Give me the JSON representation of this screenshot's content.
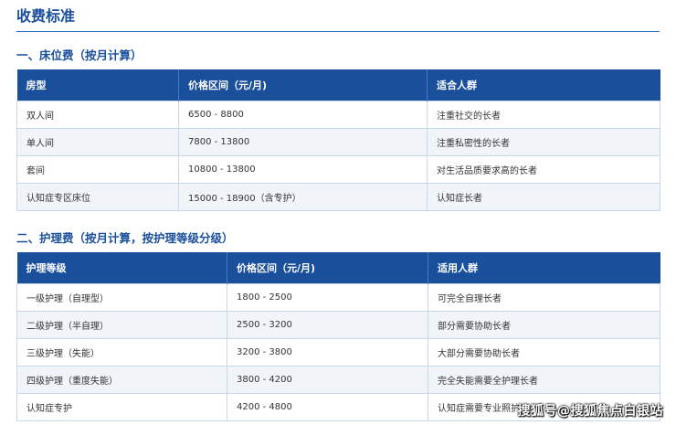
{
  "page": {
    "title": "收费标准"
  },
  "bed_fee": {
    "title": "一、床位费（按月计算）",
    "headers": [
      "房型",
      "价格区间（元/月)",
      "适合人群"
    ],
    "rows": [
      [
        "双人间",
        "6500 - 8800",
        "注重社交的长者"
      ],
      [
        "单人间",
        "7800 - 13800",
        "注重私密性的长者"
      ],
      [
        "套间",
        "10800 - 13800",
        "对生活品质要求高的长者"
      ],
      [
        "认知症专区床位",
        "15000 - 18900（含专护）",
        "认知症长者"
      ]
    ]
  },
  "care_fee": {
    "title": "二、护理费（按月计算，按护理等级分级）",
    "headers": [
      "护理等级",
      "价格区间（元/月)",
      "适用人群"
    ],
    "rows": [
      [
        "一级护理（自理型）",
        "1800 - 2500",
        "可完全自理长者"
      ],
      [
        "二级护理（半自理）",
        "2500 - 3200",
        "部分需要协助长者"
      ],
      [
        "三级护理（失能）",
        "3200 - 3800",
        "大部分需要协助长者"
      ],
      [
        "四级护理（重度失能）",
        "3800 - 4200",
        "完全失能需要全护理长者"
      ],
      [
        "认知症专护",
        "4200 - 4800",
        "认知症需要专业照护"
      ]
    ]
  },
  "watermark": "搜狐号@搜狐焦点白银站"
}
